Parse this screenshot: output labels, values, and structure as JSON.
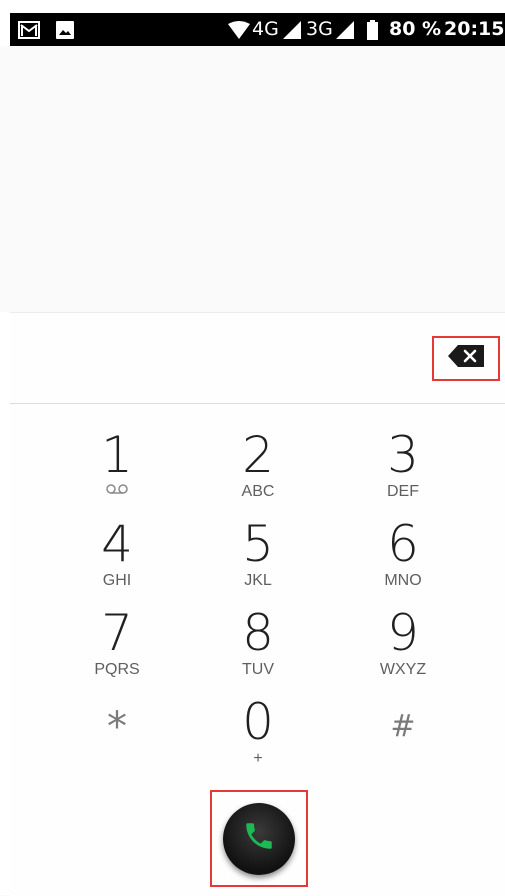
{
  "status_bar": {
    "network_4g": "4G",
    "network_3g": "3G",
    "battery": "80 %",
    "time": "20:15"
  },
  "digits_field": {
    "value": ""
  },
  "keypad": [
    {
      "digit": "1",
      "letters": ""
    },
    {
      "digit": "2",
      "letters": "ABC"
    },
    {
      "digit": "3",
      "letters": "DEF"
    },
    {
      "digit": "4",
      "letters": "GHI"
    },
    {
      "digit": "5",
      "letters": "JKL"
    },
    {
      "digit": "6",
      "letters": "MNO"
    },
    {
      "digit": "7",
      "letters": "PQRS"
    },
    {
      "digit": "8",
      "letters": "TUV"
    },
    {
      "digit": "9",
      "letters": "WXYZ"
    },
    {
      "digit": "*",
      "letters": ""
    },
    {
      "digit": "0",
      "letters": "+"
    },
    {
      "digit": "#",
      "letters": ""
    }
  ],
  "icons": {
    "voicemail": "voicemail-icon",
    "backspace": "backspace-icon",
    "call": "phone-icon"
  },
  "colors": {
    "call_icon": "#1db954",
    "highlight": "#e53935"
  }
}
